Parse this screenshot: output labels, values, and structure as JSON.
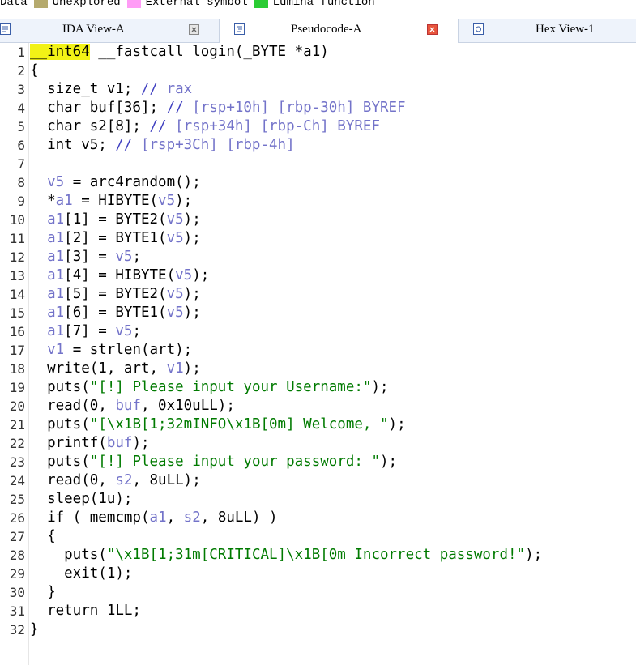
{
  "legend": [
    {
      "label": "Data",
      "color": "#ffffff"
    },
    {
      "label": "Unexplored",
      "color": "#b5aa6e"
    },
    {
      "label": "External symbol",
      "color": "#ff9cf6"
    },
    {
      "label": "Lumina function",
      "color": "#2bcc34"
    }
  ],
  "tabs": [
    {
      "label": "IDA View-A",
      "active": false
    },
    {
      "label": "Pseudocode-A",
      "active": true
    },
    {
      "label": "Hex View-1",
      "active": false
    }
  ],
  "code": {
    "lines": [
      {
        "n": "1",
        "parts": [
          [
            "hl",
            "__int64"
          ],
          [
            "k",
            " __fastcall login(_BYTE *a1)"
          ]
        ]
      },
      {
        "n": "2",
        "parts": [
          [
            "k",
            "{"
          ]
        ]
      },
      {
        "n": "3",
        "parts": [
          [
            "k",
            "  size_t v1; "
          ],
          [
            "c",
            "// "
          ],
          [
            "v",
            "rax"
          ]
        ]
      },
      {
        "n": "4",
        "parts": [
          [
            "k",
            "  char buf[36]; "
          ],
          [
            "c",
            "// "
          ],
          [
            "v",
            "[rsp+10h] [rbp-30h] BYREF"
          ]
        ]
      },
      {
        "n": "5",
        "parts": [
          [
            "k",
            "  char s2[8]; "
          ],
          [
            "c",
            "// "
          ],
          [
            "v",
            "[rsp+34h] [rbp-Ch] BYREF"
          ]
        ]
      },
      {
        "n": "6",
        "parts": [
          [
            "k",
            "  int v5; "
          ],
          [
            "c",
            "// "
          ],
          [
            "v",
            "[rsp+3Ch] [rbp-4h]"
          ]
        ]
      },
      {
        "n": "7",
        "parts": [
          [
            "k",
            ""
          ]
        ]
      },
      {
        "n": "8",
        "parts": [
          [
            "v",
            "  v5"
          ],
          [
            "k",
            " = arc4random();"
          ]
        ]
      },
      {
        "n": "9",
        "parts": [
          [
            "k",
            "  *"
          ],
          [
            "v",
            "a1"
          ],
          [
            "k",
            " = HIBYTE("
          ],
          [
            "v",
            "v5"
          ],
          [
            "k",
            ");"
          ]
        ]
      },
      {
        "n": "10",
        "parts": [
          [
            "v",
            "  a1"
          ],
          [
            "k",
            "[1] = BYTE2("
          ],
          [
            "v",
            "v5"
          ],
          [
            "k",
            ");"
          ]
        ]
      },
      {
        "n": "11",
        "parts": [
          [
            "v",
            "  a1"
          ],
          [
            "k",
            "[2] = BYTE1("
          ],
          [
            "v",
            "v5"
          ],
          [
            "k",
            ");"
          ]
        ]
      },
      {
        "n": "12",
        "parts": [
          [
            "v",
            "  a1"
          ],
          [
            "k",
            "[3] = "
          ],
          [
            "v",
            "v5"
          ],
          [
            "k",
            ";"
          ]
        ]
      },
      {
        "n": "13",
        "parts": [
          [
            "v",
            "  a1"
          ],
          [
            "k",
            "[4] = HIBYTE("
          ],
          [
            "v",
            "v5"
          ],
          [
            "k",
            ");"
          ]
        ]
      },
      {
        "n": "14",
        "parts": [
          [
            "v",
            "  a1"
          ],
          [
            "k",
            "[5] = BYTE2("
          ],
          [
            "v",
            "v5"
          ],
          [
            "k",
            ");"
          ]
        ]
      },
      {
        "n": "15",
        "parts": [
          [
            "v",
            "  a1"
          ],
          [
            "k",
            "[6] = BYTE1("
          ],
          [
            "v",
            "v5"
          ],
          [
            "k",
            ");"
          ]
        ]
      },
      {
        "n": "16",
        "parts": [
          [
            "v",
            "  a1"
          ],
          [
            "k",
            "[7] = "
          ],
          [
            "v",
            "v5"
          ],
          [
            "k",
            ";"
          ]
        ]
      },
      {
        "n": "17",
        "parts": [
          [
            "v",
            "  v1"
          ],
          [
            "k",
            " = strlen(art);"
          ]
        ]
      },
      {
        "n": "18",
        "parts": [
          [
            "k",
            "  write(1, art, "
          ],
          [
            "v",
            "v1"
          ],
          [
            "k",
            ");"
          ]
        ]
      },
      {
        "n": "19",
        "parts": [
          [
            "k",
            "  puts("
          ],
          [
            "s",
            "\"[!] Please input your Username:\""
          ],
          [
            "k",
            ");"
          ]
        ]
      },
      {
        "n": "20",
        "parts": [
          [
            "k",
            "  read(0, "
          ],
          [
            "v",
            "buf"
          ],
          [
            "k",
            ", 0x10uLL);"
          ]
        ]
      },
      {
        "n": "21",
        "parts": [
          [
            "k",
            "  puts("
          ],
          [
            "s",
            "\"[\\x1B[1;32mINFO\\x1B[0m] Welcome, \""
          ],
          [
            "k",
            ");"
          ]
        ]
      },
      {
        "n": "22",
        "parts": [
          [
            "k",
            "  printf("
          ],
          [
            "v",
            "buf"
          ],
          [
            "k",
            ");"
          ]
        ]
      },
      {
        "n": "23",
        "parts": [
          [
            "k",
            "  puts("
          ],
          [
            "s",
            "\"[!] Please input your password: \""
          ],
          [
            "k",
            ");"
          ]
        ]
      },
      {
        "n": "24",
        "parts": [
          [
            "k",
            "  read(0, "
          ],
          [
            "v",
            "s2"
          ],
          [
            "k",
            ", 8uLL);"
          ]
        ]
      },
      {
        "n": "25",
        "parts": [
          [
            "k",
            "  sleep(1u);"
          ]
        ]
      },
      {
        "n": "26",
        "parts": [
          [
            "k",
            "  if ( memcmp("
          ],
          [
            "v",
            "a1"
          ],
          [
            "k",
            ", "
          ],
          [
            "v",
            "s2"
          ],
          [
            "k",
            ", 8uLL) )"
          ]
        ]
      },
      {
        "n": "27",
        "parts": [
          [
            "k",
            "  {"
          ]
        ]
      },
      {
        "n": "28",
        "parts": [
          [
            "k",
            "    puts("
          ],
          [
            "s",
            "\"\\x1B[1;31m[CRITICAL]\\x1B[0m Incorrect password!\""
          ],
          [
            "k",
            ");"
          ]
        ]
      },
      {
        "n": "29",
        "parts": [
          [
            "k",
            "    exit(1);"
          ]
        ]
      },
      {
        "n": "30",
        "parts": [
          [
            "k",
            "  }"
          ]
        ]
      },
      {
        "n": "31",
        "parts": [
          [
            "k",
            "  return 1LL;"
          ]
        ]
      },
      {
        "n": "32",
        "parts": [
          [
            "k",
            "}"
          ]
        ]
      }
    ]
  }
}
